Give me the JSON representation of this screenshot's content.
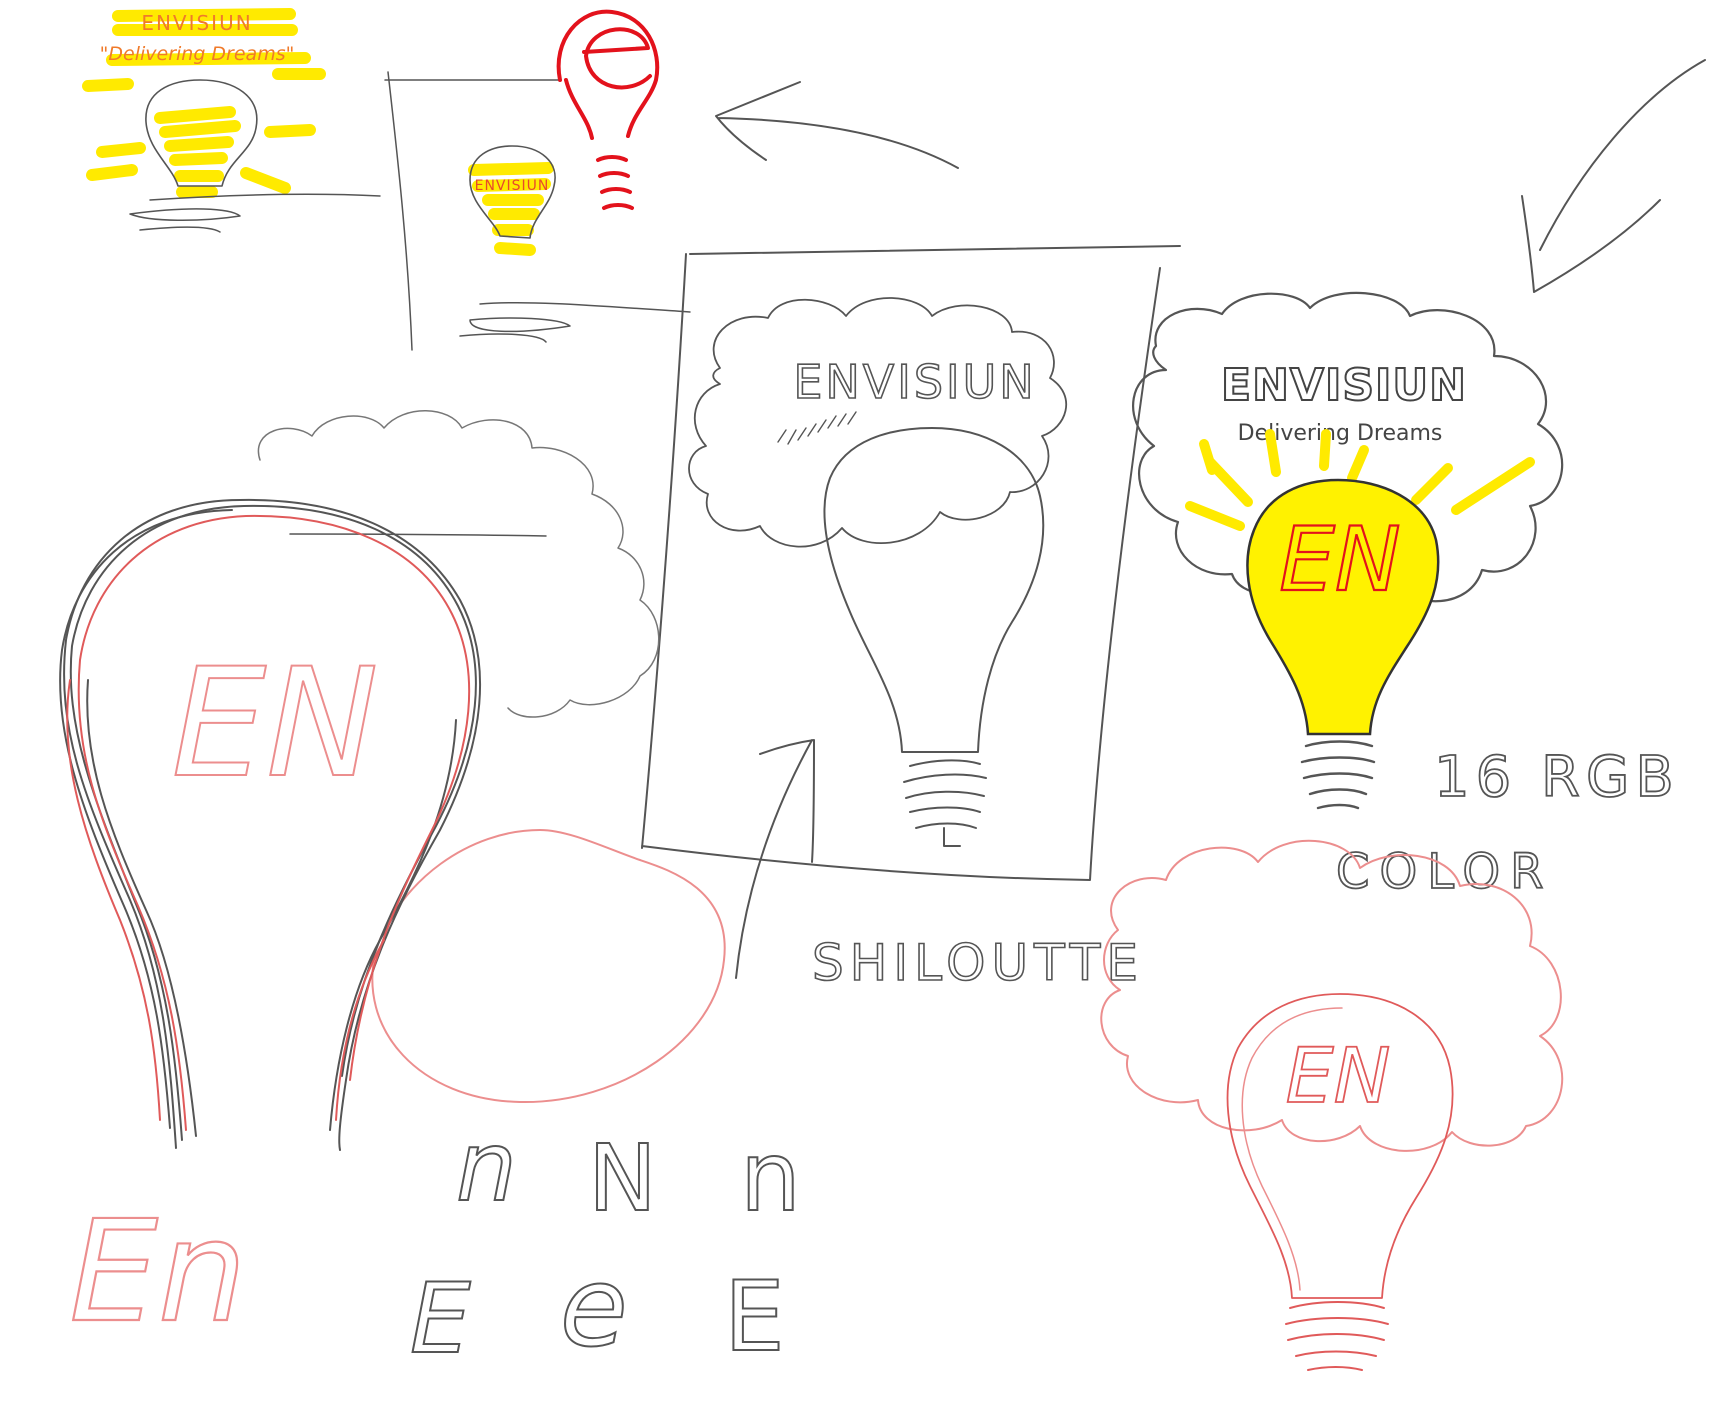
{
  "canvas": {
    "background": "#ffffff"
  },
  "colors": {
    "pencil_gray": "#555555",
    "sketch_red": "#e05a5a",
    "light_red": "#ec8e8e",
    "bright_red": "#e3121c",
    "highlight_yellow": "#ffea00",
    "bulb_fill_yellow": "#fff200",
    "orange_text": "#f07a2a"
  },
  "thumbnail": {
    "brand": "ENVISIUN",
    "tagline": "\"Delivering Dreams\"",
    "bulb_label": "ENVISIUN"
  },
  "poster": {
    "brand": "ENVISIUN"
  },
  "final_logo": {
    "brand": "ENVISIUN",
    "tagline": "Delivering Dreams",
    "monogram": "EN"
  },
  "notes": {
    "silhouette": "SHILOUTTE",
    "color_count": "16 RGB",
    "color_word": "COLOR"
  },
  "big_sketch": {
    "monogram": "EN"
  },
  "letter_studies": {
    "n_variants": [
      "n",
      "N",
      "n"
    ],
    "e_variants": [
      "E",
      "e",
      "E"
    ],
    "script_mark": "En"
  },
  "icons": [
    "arrow-left-icon",
    "arrow-down-left-icon",
    "arrow-up-icon",
    "lightbulb-icon",
    "cloud-icon",
    "e-lightbulb-icon"
  ]
}
